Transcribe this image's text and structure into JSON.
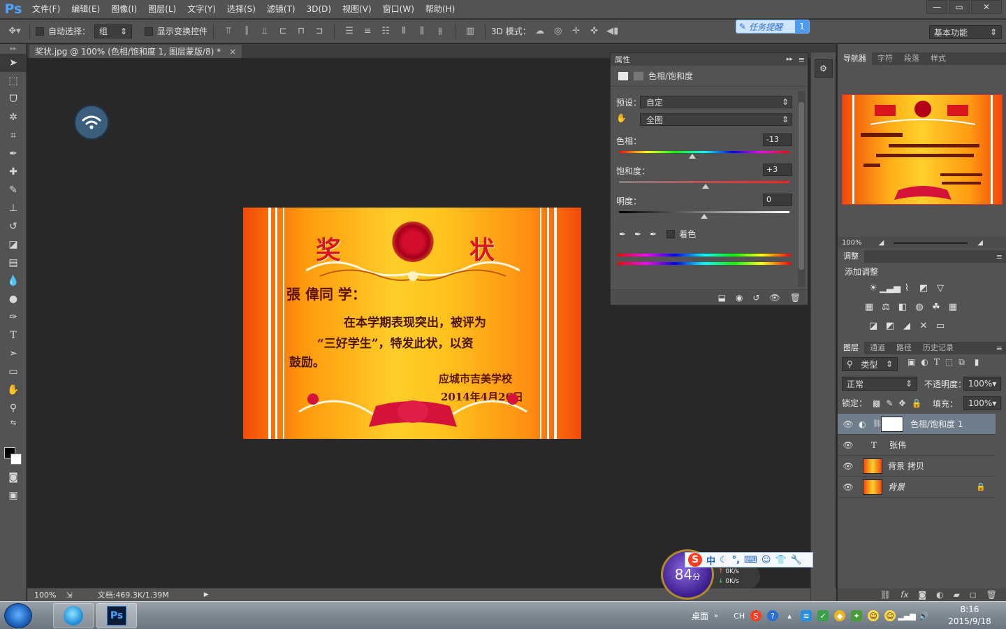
{
  "app": {
    "logo": "Ps"
  },
  "menu": [
    "文件(F)",
    "编辑(E)",
    "图像(I)",
    "图层(L)",
    "文字(Y)",
    "选择(S)",
    "滤镜(T)",
    "3D(D)",
    "视图(V)",
    "窗口(W)",
    "帮助(H)"
  ],
  "window_controls": {
    "minimize": "—",
    "restore": "▭",
    "close": "✕"
  },
  "options": {
    "auto_select_label": "自动选择：",
    "auto_select_value": "组",
    "show_transform_label": "显示变换控件",
    "mode_3d_label": "3D 模式：",
    "task_remind": "任务提醒",
    "task_remind_count": "1",
    "workspace": "基本功能"
  },
  "document": {
    "tab_title": "奖状.jpg @ 100% (色相/饱和度 1, 图层蒙版/8) *",
    "close": "×"
  },
  "certificate": {
    "title_left": "奖",
    "title_right": "状",
    "name_line": "張 偉同 学：",
    "body_line1": "在本学期表现突出，被评为",
    "body_line2": "“三好学生”，特发此状，以资",
    "body_line3": "鼓励。",
    "school": "应城市吉美学校",
    "date": "2014年4月26日"
  },
  "status": {
    "zoom": "100%",
    "doc_info": "文档:469.3K/1.39M"
  },
  "properties": {
    "panel_tab": "属性",
    "title": "色相/饱和度",
    "preset_label": "预设：",
    "preset_value": "自定",
    "channel_value": "全图",
    "hue_label": "色相：",
    "hue_value": "-13",
    "hue_fraction": 0.43,
    "saturation_label": "饱和度：",
    "saturation_value": "+3",
    "saturation_fraction": 0.51,
    "lightness_label": "明度：",
    "lightness_value": "0",
    "lightness_fraction": 0.5,
    "colorize_label": "着色"
  },
  "navigator": {
    "tabs": [
      "导航器",
      "字符",
      "段落",
      "样式"
    ],
    "zoom": "100%"
  },
  "adjustments": {
    "tab": "调整",
    "add_label": "添加调整"
  },
  "layers": {
    "tabs": [
      "图层",
      "通道",
      "路径",
      "历史记录"
    ],
    "filter_kind": "类型",
    "blend_mode": "正常",
    "opacity_label": "不透明度：",
    "opacity_value": "100%",
    "lock_label": "锁定：",
    "fill_label": "填充：",
    "fill_value": "100%",
    "items": [
      {
        "name": "色相/饱和度 1",
        "kind": "adjustment",
        "selected": true
      },
      {
        "name": "张伟",
        "kind": "text",
        "selected": false
      },
      {
        "name": "背景 拷贝",
        "kind": "image",
        "selected": false
      },
      {
        "name": "背景",
        "kind": "image-locked",
        "selected": false
      }
    ]
  },
  "score_widget": {
    "score": "84",
    "unit": "分",
    "up": "0K/s",
    "down": "0K/s"
  },
  "ime": {
    "logo": "S",
    "lang": "中"
  },
  "taskbar": {
    "desktop_label": "桌面",
    "input_lang": "CH",
    "time": "8:16",
    "date": "2015/9/18"
  },
  "colors": {
    "accent": "#4da3ff",
    "panel": "#535353",
    "canvas": "#282828"
  }
}
